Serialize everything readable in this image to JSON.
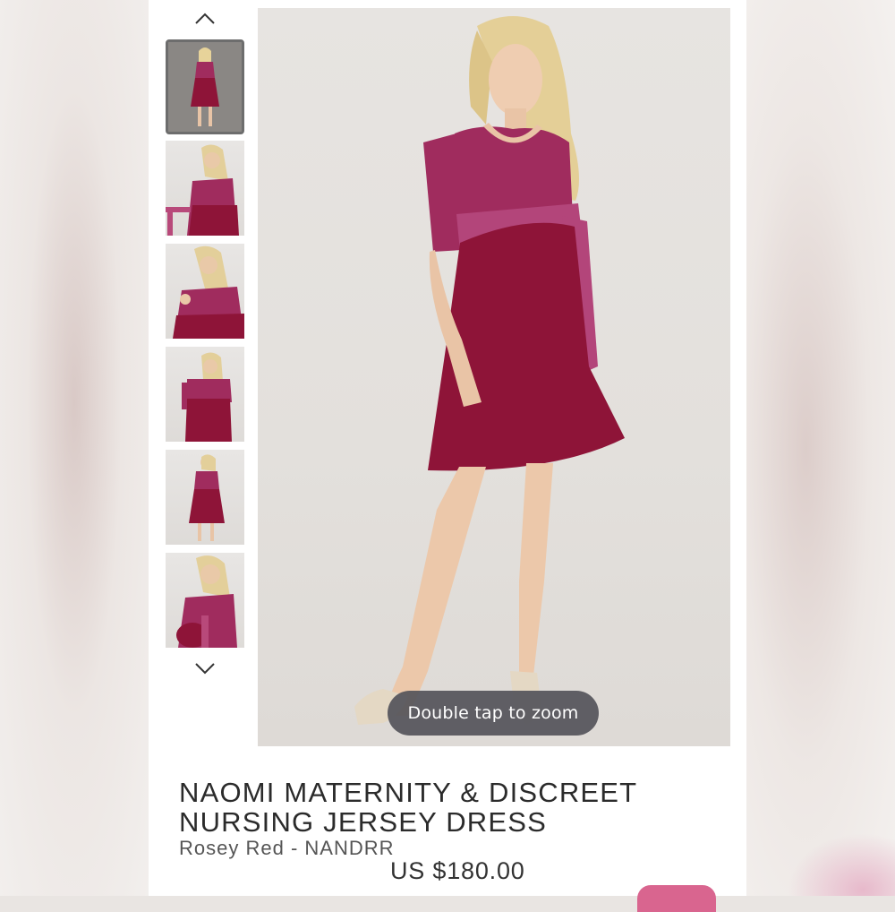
{
  "gallery": {
    "thumbnail_count": 6,
    "active_index": 0,
    "zoom_hint": "Double tap to zoom",
    "icons": {
      "up": "chevron-up-icon",
      "down": "chevron-down-icon"
    }
  },
  "product": {
    "title_line1": "NAOMI MATERNITY & DISCREET",
    "title_line2": "NURSING JERSEY DRESS",
    "color_sku": "Rosey Red - NANDRR",
    "price": "US $180.00"
  },
  "colors": {
    "dress_top": "#a02c5e",
    "dress_skirt": "#8e1438",
    "accent": "#d9658f"
  }
}
